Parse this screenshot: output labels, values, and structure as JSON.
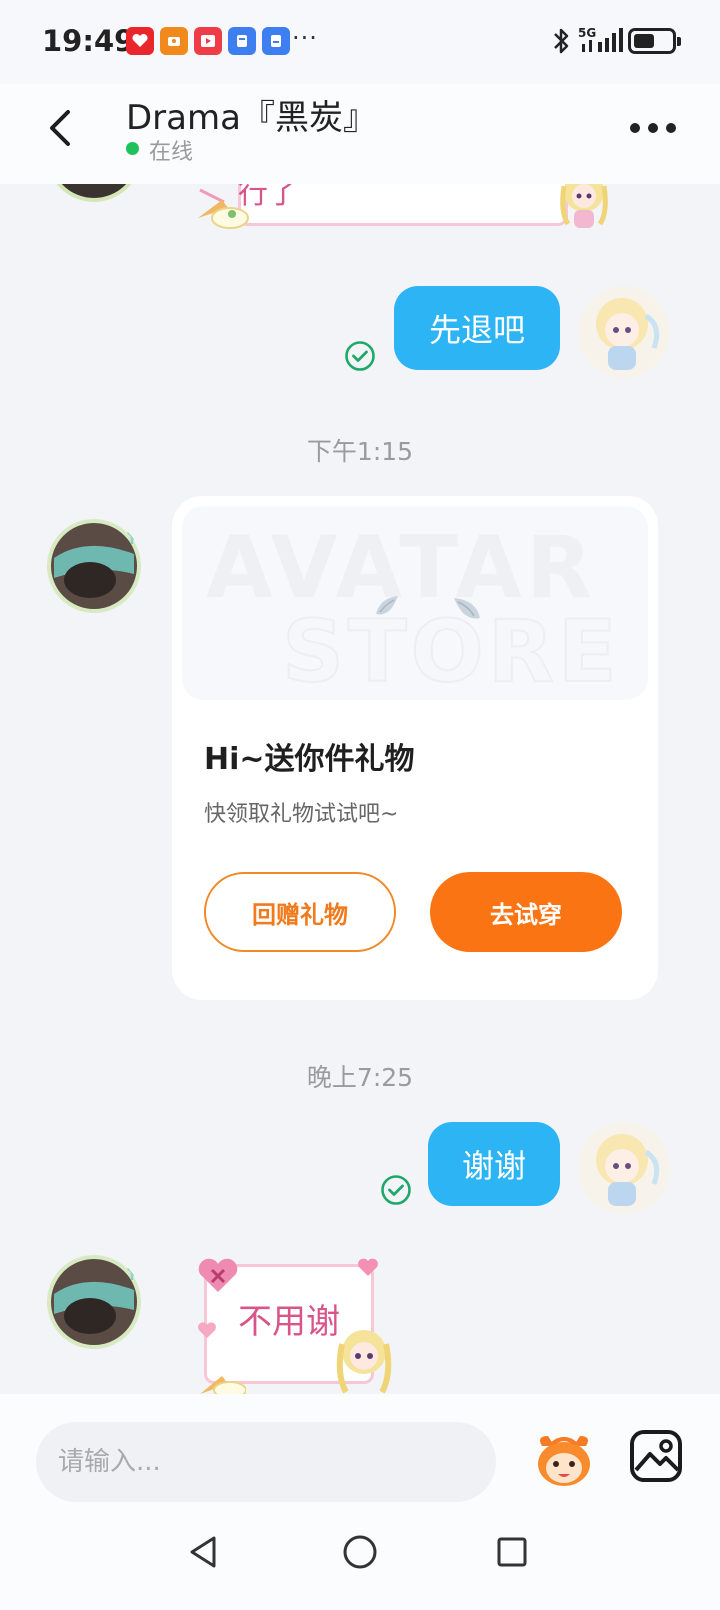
{
  "status_bar": {
    "time": "19:49",
    "more_indicator": "···",
    "network": "5G",
    "battery_level": 0.55,
    "notification_icons": [
      "app-red-heart-icon",
      "app-orange-icon",
      "app-video-icon",
      "app-blue-icon",
      "app-blue-icon-2"
    ]
  },
  "header": {
    "title": "Drama『黑炭』",
    "status": "在线",
    "status_color": "#20c15a"
  },
  "messages": {
    "partial_sticker_text": "行了",
    "msg1_text": "先退吧",
    "time1": "下午1:15",
    "gift_card": {
      "banner_watermark_1": "AVATAR",
      "banner_watermark_2": "STORE",
      "title": "Hi~送你件礼物",
      "subtitle": "快领取礼物试试吧~",
      "return_button": "回赠礼物",
      "try_button": "去试穿"
    },
    "time2": "晚上7:25",
    "msg2_text": "谢谢",
    "sticker_text": "不用谢"
  },
  "input": {
    "placeholder": "请输入..."
  },
  "colors": {
    "my_bubble": "#2cb4f5",
    "accent_orange": "#fa7414",
    "read_check": "#1fa86a"
  }
}
